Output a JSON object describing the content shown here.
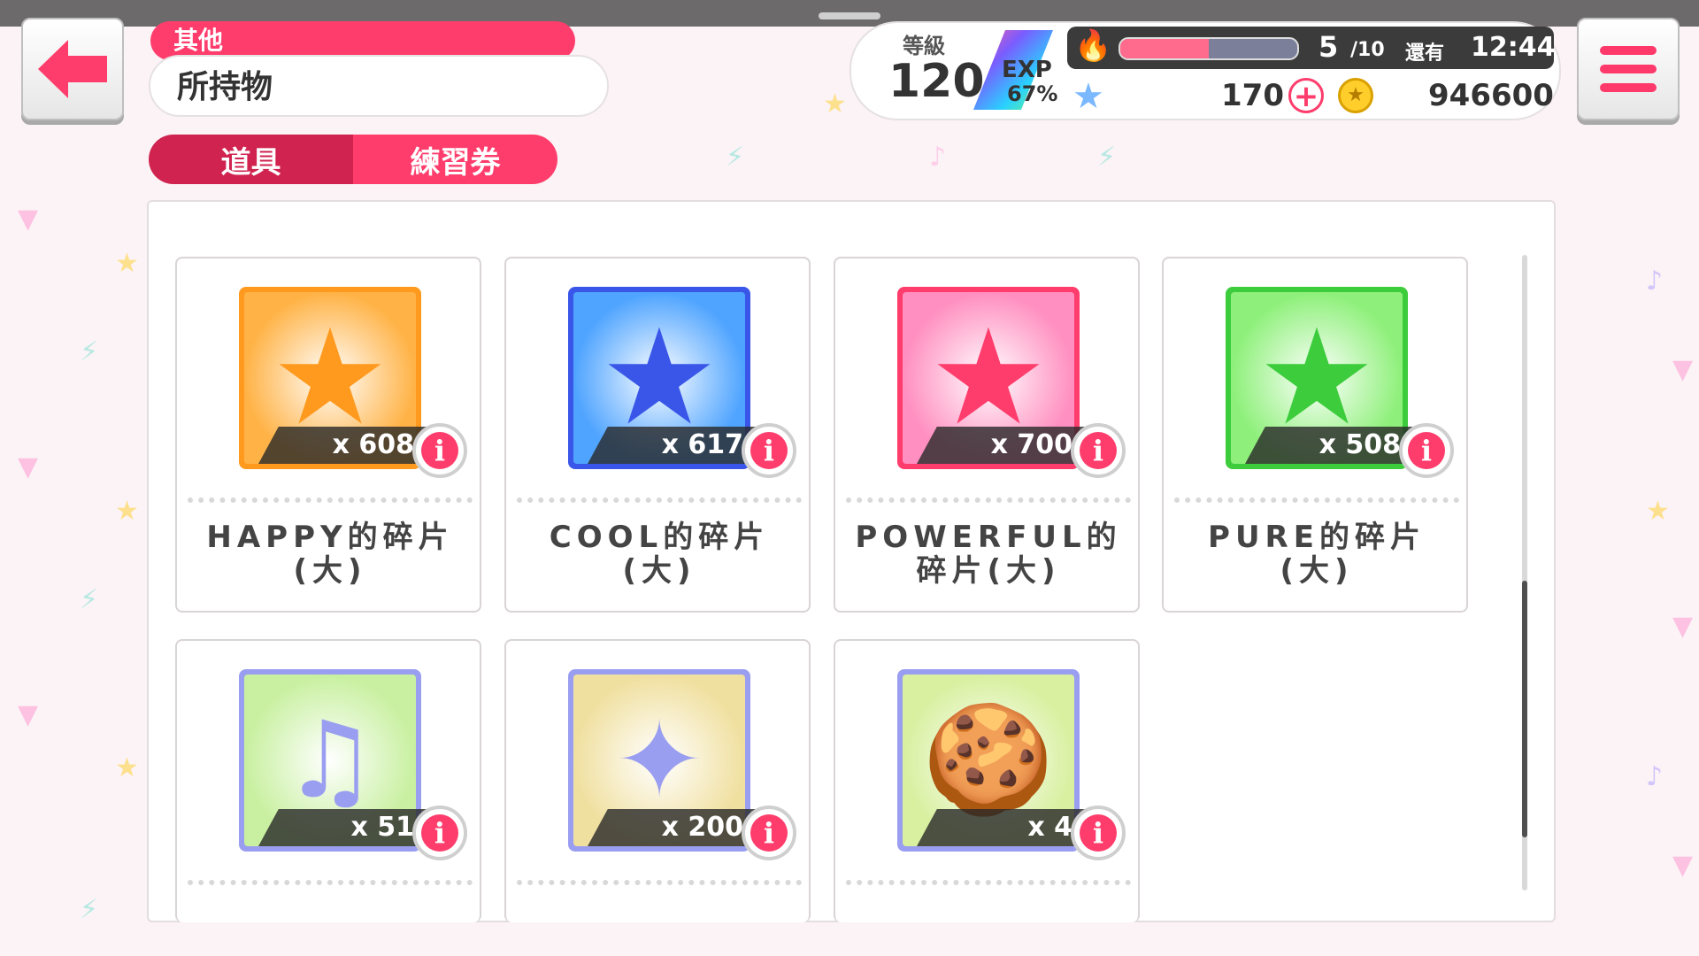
{
  "header": {
    "category": "其他",
    "title": "所持物"
  },
  "tabs": [
    {
      "label": "道具",
      "active": true
    },
    {
      "label": "練習券",
      "active": false
    }
  ],
  "status": {
    "level_label": "等級",
    "level": "120",
    "exp_label": "EXP",
    "exp_percent": "67%",
    "stamina_current": "5",
    "stamina_max": "/10",
    "stamina_fill_fraction": 0.5,
    "remain_label": "還有",
    "remain_time": "12:44",
    "stars": "170",
    "plus": "+",
    "coins": "946600"
  },
  "items": [
    {
      "name": "HAPPY的碎片(大)",
      "qty": "x 608",
      "color": "#ff9a1f",
      "bg": "#ffb347",
      "icon": "star-happy-icon",
      "glyph": "★"
    },
    {
      "name": "COOL的碎片(大)",
      "qty": "x 617",
      "color": "#3a56e8",
      "bg": "#4fa4ff",
      "icon": "star-cool-icon",
      "glyph": "★"
    },
    {
      "name": "POWERFUL的碎片(大)",
      "qty": "x 700",
      "color": "#ff3d6c",
      "bg": "#ff8fc0",
      "icon": "star-powerful-icon",
      "glyph": "★"
    },
    {
      "name": "PURE的碎片(大)",
      "qty": "x 508",
      "color": "#3ccc3c",
      "bg": "#8ef07a",
      "icon": "star-pure-icon",
      "glyph": "★"
    },
    {
      "name": "",
      "qty": "x 51",
      "color": "#9a9ef0",
      "bg": "#c8f0a0",
      "icon": "music-drop-icon",
      "glyph": "♫"
    },
    {
      "name": "",
      "qty": "x 200",
      "color": "#9a9ef0",
      "bg": "#f0e0a0",
      "icon": "star-drop-icon",
      "glyph": "✦"
    },
    {
      "name": "",
      "qty": "x 4",
      "color": "#9a9ef0",
      "bg": "#d8f0a0",
      "icon": "bear-cookie-icon",
      "glyph": "🍪"
    }
  ],
  "info_glyph": "i"
}
